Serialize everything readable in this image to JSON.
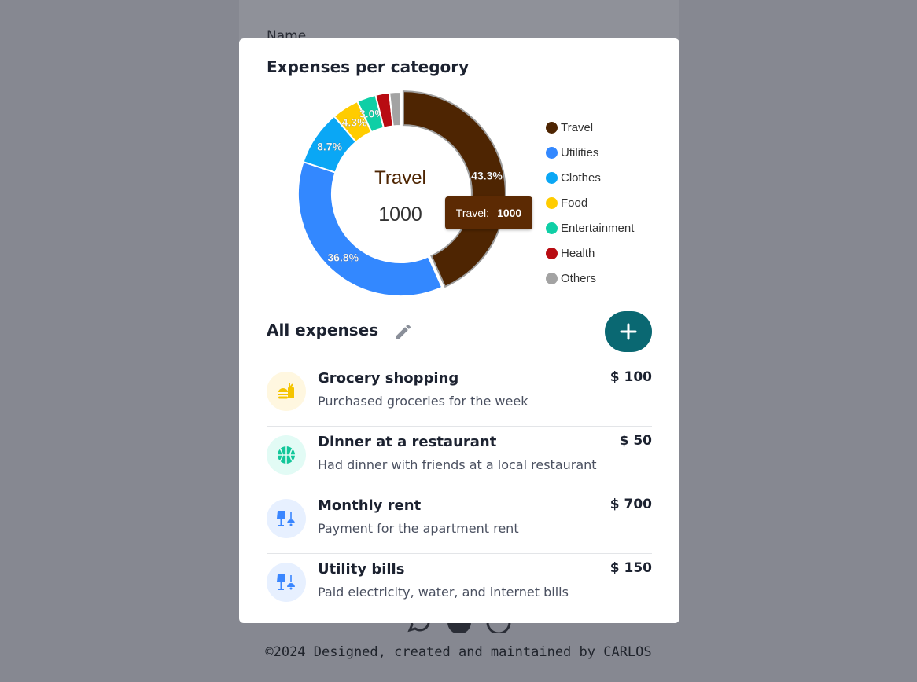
{
  "background": {
    "form_label": "Name",
    "footer": "©2024 Designed, created and maintained by CARLOS"
  },
  "chart": {
    "title": "Expenses per category",
    "center_label": "Travel",
    "center_value": "1000",
    "tooltip_label": "Travel:",
    "tooltip_value": "1000"
  },
  "chart_data": {
    "type": "pie",
    "title": "Expenses per category",
    "categories": [
      "Travel",
      "Utilities",
      "Clothes",
      "Food",
      "Entertainment",
      "Health",
      "Others"
    ],
    "values": [
      43.3,
      36.8,
      8.7,
      4.3,
      3.0,
      2.2,
      1.7
    ],
    "data_labels": [
      "43.3%",
      "36.8%",
      "8.7%",
      "4.3%",
      "3.0%",
      "",
      ""
    ],
    "colors": [
      "#4e2502",
      "#3388ff",
      "#0aa7f5",
      "#ffcc00",
      "#0fcfa6",
      "#b80c12",
      "#a3a3a3"
    ],
    "legend_position": "right",
    "highlighted": "Travel"
  },
  "expenses": {
    "title": "All expenses",
    "items": [
      {
        "title": "Grocery shopping",
        "desc": "Purchased groceries for the week",
        "amount": "$ 100",
        "icon": "food-icon",
        "icon_bg": "#fff7e0"
      },
      {
        "title": "Dinner at a restaurant",
        "desc": "Had dinner with friends at a local restaurant",
        "amount": "$ 50",
        "icon": "basketball-icon",
        "icon_bg": "#e2fbf5"
      },
      {
        "title": "Monthly rent",
        "desc": "Payment for the apartment rent",
        "amount": "$ 700",
        "icon": "lamp-icon",
        "icon_bg": "#e7f0ff"
      },
      {
        "title": "Utility bills",
        "desc": "Paid electricity, water, and internet bills",
        "amount": "$ 150",
        "icon": "lamp-icon",
        "icon_bg": "#e7f0ff"
      }
    ]
  }
}
